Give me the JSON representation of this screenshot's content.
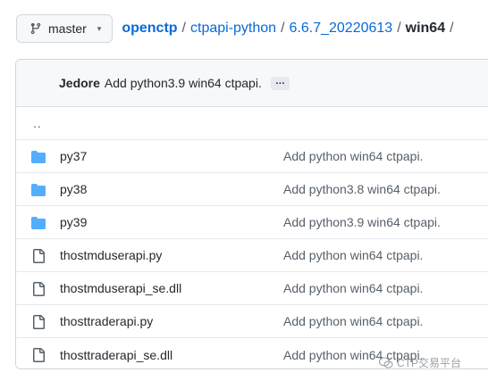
{
  "branch": {
    "icon": "git-branch-icon",
    "label": "master",
    "caret": "▾"
  },
  "breadcrumb": {
    "items": [
      "openctp",
      "ctpapi-python",
      "6.6.7_20220613"
    ],
    "current": "win64",
    "separator": "/"
  },
  "commit": {
    "author": "Jedore",
    "message": "Add python3.9 win64 ctpapi.",
    "ellipsis": "…"
  },
  "files": [
    {
      "type": "parent",
      "name": "..",
      "message": ""
    },
    {
      "type": "folder",
      "icon": "folder-icon",
      "name": "py37",
      "message": "Add python win64 ctpapi."
    },
    {
      "type": "folder",
      "icon": "folder-icon",
      "name": "py38",
      "message": "Add python3.8 win64 ctpapi."
    },
    {
      "type": "folder",
      "icon": "folder-icon",
      "name": "py39",
      "message": "Add python3.9 win64 ctpapi."
    },
    {
      "type": "file",
      "icon": "file-icon",
      "name": "thostmduserapi.py",
      "message": "Add python win64 ctpapi."
    },
    {
      "type": "file",
      "icon": "file-icon",
      "name": "thostmduserapi_se.dll",
      "message": "Add python win64 ctpapi."
    },
    {
      "type": "file",
      "icon": "file-icon",
      "name": "thosttraderapi.py",
      "message": "Add python win64 ctpapi."
    },
    {
      "type": "file",
      "icon": "file-icon",
      "name": "thosttraderapi_se.dll",
      "message": "Add python win64 ctpapi."
    }
  ],
  "watermark": {
    "icon": "wechat-icon",
    "text": "CTP交易平台"
  },
  "colors": {
    "link": "#0969da",
    "folder": "#54aeff",
    "file_icon": "#57606a",
    "border": "#d0d7de"
  }
}
